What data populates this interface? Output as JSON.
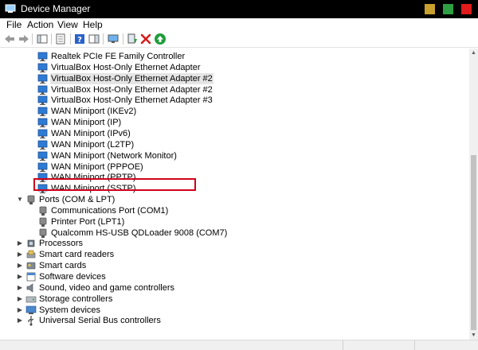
{
  "window": {
    "title": "Device Manager",
    "controls": [
      {
        "name": "minimize",
        "color": "#c8a02e"
      },
      {
        "name": "maximize",
        "color": "#2ea043"
      },
      {
        "name": "close",
        "color": "#e01b1b"
      }
    ]
  },
  "menu": [
    "File",
    "Action",
    "View",
    "Help"
  ],
  "toolbar": {
    "icons": [
      "back-icon",
      "forward-icon",
      "show-hide-console-tree-icon",
      "properties-icon",
      "help-icon",
      "action-pane-icon",
      "display-monitor-icon",
      "update-driver-icon",
      "uninstall-icon",
      "enable-device-icon"
    ]
  },
  "colors": {
    "highlight": "#d0021b",
    "selected_bg": "#e5e5e5",
    "network_icon": "#2e7bd6"
  },
  "tree": {
    "network_items": [
      "Realtek PCIe FE Family Controller",
      "VirtualBox Host-Only Ethernet Adapter",
      "VirtualBox Host-Only Ethernet Adapter #2",
      "VirtualBox Host-Only Ethernet Adapter #2",
      "VirtualBox Host-Only Ethernet Adapter #3",
      "WAN Miniport (IKEv2)",
      "WAN Miniport (IP)",
      "WAN Miniport (IPv6)",
      "WAN Miniport (L2TP)",
      "WAN Miniport (Network Monitor)",
      "WAN Miniport (PPPOE)",
      "WAN Miniport (PPTP)",
      "WAN Miniport (SSTP)"
    ],
    "selected_network_index": 2,
    "ports": {
      "label": "Ports (COM & LPT)",
      "expanded": true,
      "items": [
        "Communications Port (COM1)",
        "Printer Port (LPT1)",
        "Qualcomm HS-USB QDLoader 9008 (COM7)"
      ],
      "highlighted_index": 2
    },
    "categories": [
      {
        "label": "Processors",
        "icon": "processor-icon"
      },
      {
        "label": "Smart card readers",
        "icon": "smart-card-reader-icon"
      },
      {
        "label": "Smart cards",
        "icon": "smart-card-icon"
      },
      {
        "label": "Software devices",
        "icon": "software-device-icon"
      },
      {
        "label": "Sound, video and game controllers",
        "icon": "speaker-icon"
      },
      {
        "label": "Storage controllers",
        "icon": "storage-controller-icon"
      },
      {
        "label": "System devices",
        "icon": "system-device-icon"
      },
      {
        "label": "Universal Serial Bus controllers",
        "icon": "usb-controller-icon"
      }
    ]
  }
}
